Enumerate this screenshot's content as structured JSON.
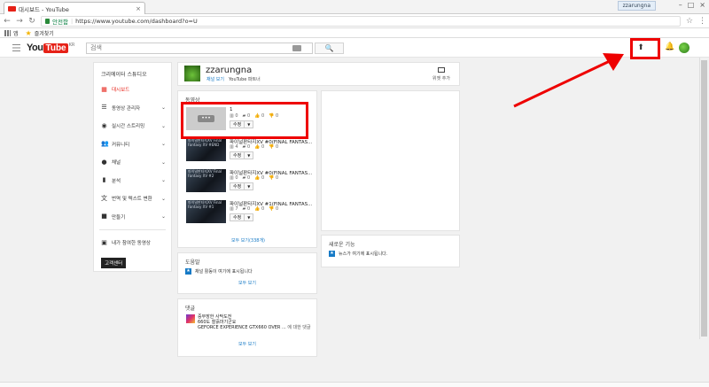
{
  "browser": {
    "tab_title": "대시보드 - YouTube",
    "tab_close": "×",
    "user_chip": "zzarungna",
    "window_controls": [
      "–",
      "□",
      "×"
    ],
    "nav": {
      "back": "←",
      "forward": "→",
      "reload": "↻"
    },
    "secure_label": "안전함",
    "url": "https://www.youtube.com/dashboard?o=U",
    "bookmarks": {
      "apps": "앱",
      "favorites": "즐겨찾기"
    }
  },
  "masthead": {
    "logo_you": "You",
    "logo_tube": "Tube",
    "logo_region": "KR",
    "search_placeholder": "검색",
    "search_button": "🔍",
    "upload_icon": "⬆",
    "bell_icon": "🔔"
  },
  "sidebar": {
    "title": "크리에이터 스튜디오",
    "items": [
      {
        "label": "대시보드",
        "icon": "▦",
        "active": true,
        "chevron": ""
      },
      {
        "label": "동영상 관리자",
        "icon": "☰",
        "active": false,
        "chevron": "⌄"
      },
      {
        "label": "실시간 스트리밍",
        "icon": "◉",
        "active": false,
        "chevron": "⌄"
      },
      {
        "label": "커뮤니티",
        "icon": "👥",
        "active": false,
        "chevron": "⌄"
      },
      {
        "label": "채널",
        "icon": "●",
        "active": false,
        "chevron": "⌄"
      },
      {
        "label": "분석",
        "icon": "▮",
        "active": false,
        "chevron": "⌄"
      },
      {
        "label": "번역 및 텍스트 변환",
        "icon": "文",
        "active": false,
        "chevron": "⌄"
      },
      {
        "label": "만들기",
        "icon": "■",
        "active": false,
        "chevron": "⌄"
      }
    ],
    "extra_item": {
      "label": "내가 참여한 동영상",
      "icon": "▣"
    },
    "classic_button": "고객센터"
  },
  "channel": {
    "name": "zzarungna",
    "view_channel": "채널 보기",
    "youtube_partner": "YouTube 파트너",
    "view_add_label": "위젯 추가"
  },
  "videos_card": {
    "title": "동영상",
    "videos": [
      {
        "title": "1",
        "thumb_text": "",
        "views": "0",
        "comments": "0",
        "likes": "0",
        "dislikes": "0"
      },
      {
        "title": "파이널판타지XV #0(FINAL FANTAS...",
        "thumb_text": "파이널판타지XV Final Fantasy XV #END",
        "views": "4",
        "comments": "0",
        "likes": "0",
        "dislikes": "0"
      },
      {
        "title": "파이널판타지XV #0(FINAL FANTAS...",
        "thumb_text": "파이널판타지XV Final Fantasy XV #2",
        "views": "0",
        "comments": "0",
        "likes": "0",
        "dislikes": "0"
      },
      {
        "title": "파이널판타지XV #1(FINAL FANTAS...",
        "thumb_text": "파이널판타지XV Final Fantasy XV #1",
        "views": "7",
        "comments": "0",
        "likes": "0",
        "dislikes": "0"
      }
    ],
    "edit_label": "수정",
    "dropdown_label": "▼",
    "more_button": "•••",
    "view_all": "모두 보기(338개)"
  },
  "community_card": {
    "title": "도움말",
    "note": "채널 활동이 여기에 표시됩니다",
    "view_all": "모두 보기"
  },
  "whatsnew_card": {
    "title": "새로운 기능",
    "note": "뉴스가 여기에 표시됩니다."
  },
  "comments_card": {
    "title": "댓글",
    "line1": "중무장한 사막도전",
    "line2": "660도 찰흙마기군요",
    "line3": "GEFORCE EXPERIENCE GTX660 OVER ...",
    "line3_tail": "에 대한 댓글",
    "view_all": "모두 보기"
  },
  "colors": {
    "accent_red": "#e62117",
    "link_blue": "#167ac6",
    "highlight_box": "#e00000"
  }
}
